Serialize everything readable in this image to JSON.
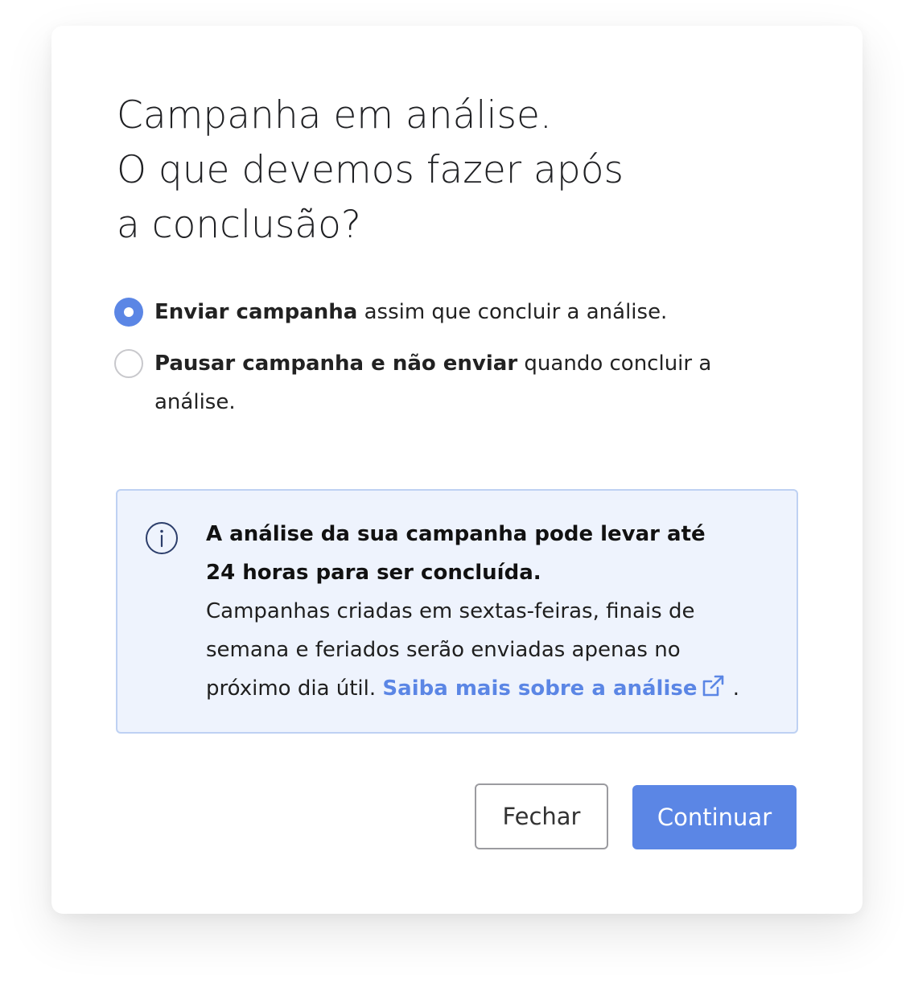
{
  "modal": {
    "title_lines": [
      "Campanha em análise.",
      "O que devemos fazer após",
      "a conclusão?"
    ]
  },
  "options": [
    {
      "bold": "Enviar campanha",
      "text": " assim que concluir a análise.",
      "selected": true
    },
    {
      "bold": "Pausar campanha e não enviar",
      "text": " quando concluir a análise.",
      "selected": false
    }
  ],
  "info": {
    "icon": "info-circle-icon",
    "bold_line_1": "A análise da sua campanha pode levar até",
    "bold_line_2": "24 horas para ser concluída.",
    "body_line_1": "Campanhas criadas em sextas-feiras, finais de",
    "body_line_2": "semana e feriados serão enviadas apenas no",
    "body_line_3_prefix": "próximo dia útil. ",
    "link_label": "Saiba mais sobre a análise",
    "link_icon": "external-link-icon",
    "suffix": " ."
  },
  "buttons": {
    "close_label": "Fechar",
    "continue_label": "Continuar"
  },
  "colors": {
    "accent": "#5b86e5",
    "info_background": "#eef3fd",
    "info_border": "#bed1f3"
  }
}
